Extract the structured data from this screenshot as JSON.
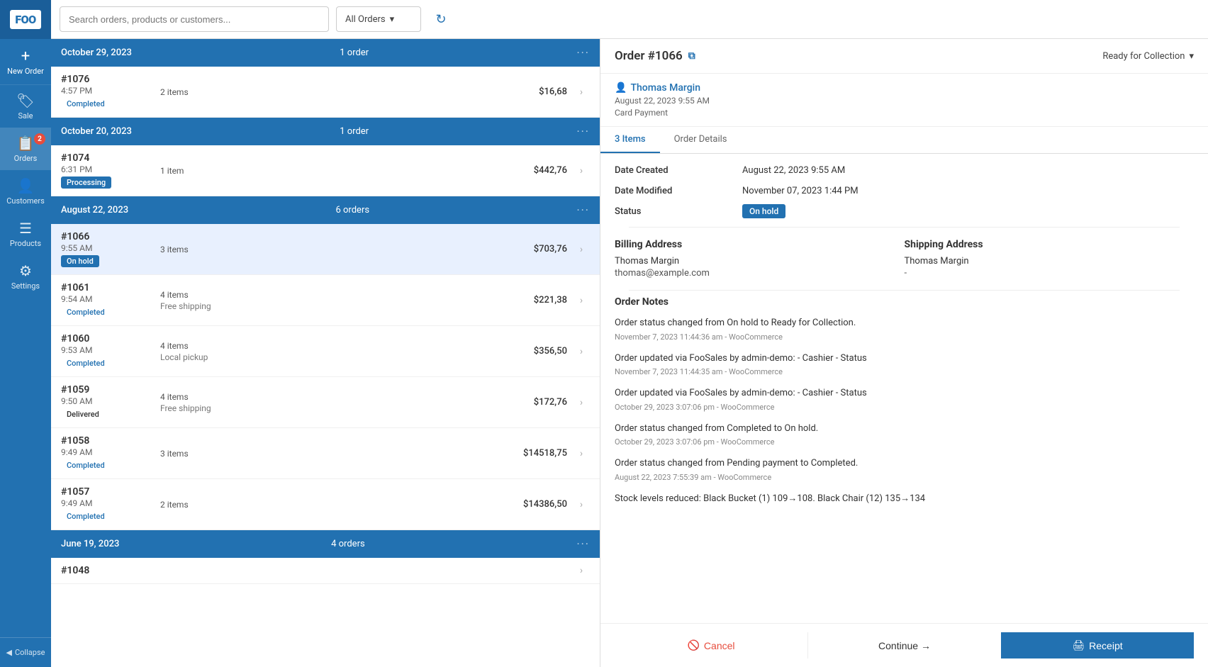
{
  "app": {
    "logo": "FOO"
  },
  "sidebar": {
    "new_order_label": "New Order",
    "collapse_label": "Collapse",
    "items": [
      {
        "id": "sale",
        "label": "Sale",
        "icon": "🏷"
      },
      {
        "id": "orders",
        "label": "Orders",
        "icon": "📋",
        "badge": "2"
      },
      {
        "id": "customers",
        "label": "Customers",
        "icon": "👤"
      },
      {
        "id": "products",
        "label": "Products",
        "icon": "☰"
      },
      {
        "id": "settings",
        "label": "Settings",
        "icon": "⚙"
      }
    ]
  },
  "topbar": {
    "search_placeholder": "Search orders, products or customers...",
    "filter_label": "All Orders",
    "filter_chevron": "▾"
  },
  "order_groups": [
    {
      "date": "October 29, 2023",
      "count": "1 order",
      "orders": [
        {
          "number": "#1076",
          "time": "4:57 PM",
          "status": "Completed",
          "status_type": "completed",
          "items": "2 items",
          "shipping": "",
          "amount": "$16,68"
        }
      ]
    },
    {
      "date": "October 20, 2023",
      "count": "1 order",
      "orders": [
        {
          "number": "#1074",
          "time": "6:31 PM",
          "status": "Processing",
          "status_type": "processing",
          "items": "1 item",
          "shipping": "",
          "amount": "$442,76"
        }
      ]
    },
    {
      "date": "August 22, 2023",
      "count": "6 orders",
      "orders": [
        {
          "number": "#1066",
          "time": "9:55 AM",
          "status": "On hold",
          "status_type": "onhold",
          "items": "3 items",
          "shipping": "",
          "amount": "$703,76",
          "selected": true
        },
        {
          "number": "#1061",
          "time": "9:54 AM",
          "status": "Completed",
          "status_type": "completed",
          "items": "4 items",
          "shipping": "Free shipping",
          "amount": "$221,38"
        },
        {
          "number": "#1060",
          "time": "9:53 AM",
          "status": "Completed",
          "status_type": "completed",
          "items": "4 items",
          "shipping": "Local pickup",
          "amount": "$356,50"
        },
        {
          "number": "#1059",
          "time": "9:50 AM",
          "status": "Delivered",
          "status_type": "delivered",
          "items": "4 items",
          "shipping": "Free shipping",
          "amount": "$172,76"
        },
        {
          "number": "#1058",
          "time": "9:49 AM",
          "status": "Completed",
          "status_type": "completed",
          "items": "3 items",
          "shipping": "",
          "amount": "$14518,75"
        },
        {
          "number": "#1057",
          "time": "9:49 AM",
          "status": "Completed",
          "status_type": "completed",
          "items": "2 items",
          "shipping": "",
          "amount": "$14386,50"
        }
      ]
    },
    {
      "date": "June 19, 2023",
      "count": "4 orders",
      "orders": [
        {
          "number": "#1048",
          "time": "",
          "status": "",
          "status_type": "",
          "items": "",
          "shipping": "",
          "amount": ""
        }
      ]
    }
  ],
  "order_detail": {
    "title": "Order #1066",
    "status_label": "Ready for Collection",
    "customer": {
      "name": "Thomas Margin",
      "date": "August 22, 2023 9:55 AM",
      "payment": "Card Payment"
    },
    "tabs": [
      {
        "id": "items",
        "label": "3 Items",
        "active": true
      },
      {
        "id": "order_details",
        "label": "Order Details",
        "active": false
      }
    ],
    "details": {
      "date_created_label": "Date Created",
      "date_created_value": "August 22, 2023 9:55 AM",
      "date_modified_label": "Date Modified",
      "date_modified_value": "November 07, 2023 1:44 PM",
      "status_label": "Status",
      "status_value": "On hold"
    },
    "billing": {
      "title": "Billing Address",
      "name": "Thomas Margin",
      "email": "thomas@example.com"
    },
    "shipping": {
      "title": "Shipping Address",
      "name": "Thomas Margin",
      "email": "-"
    },
    "notes": {
      "title": "Order Notes",
      "items": [
        {
          "text": "Order status changed from On hold to Ready for Collection.",
          "meta": "November 7, 2023 11:44:36 am - WooCommerce"
        },
        {
          "text": "Order updated via FooSales by admin-demo: - Cashier - Status",
          "meta": "November 7, 2023 11:44:35 am - WooCommerce"
        },
        {
          "text": "Order updated via FooSales by admin-demo: - Cashier - Status",
          "meta": "October 29, 2023 3:07:06 pm - WooCommerce"
        },
        {
          "text": "Order status changed from Completed to On hold.",
          "meta": "October 29, 2023 3:07:06 pm - WooCommerce"
        },
        {
          "text": "Order status changed from Pending payment to Completed.",
          "meta": "August 22, 2023 7:55:39 am - WooCommerce"
        },
        {
          "text": "Stock levels reduced: Black Bucket (1) 109→108. Black Chair (12) 135→134",
          "meta": ""
        }
      ]
    },
    "footer": {
      "cancel_label": "Cancel",
      "continue_label": "Continue →",
      "receipt_label": "Receipt"
    }
  }
}
